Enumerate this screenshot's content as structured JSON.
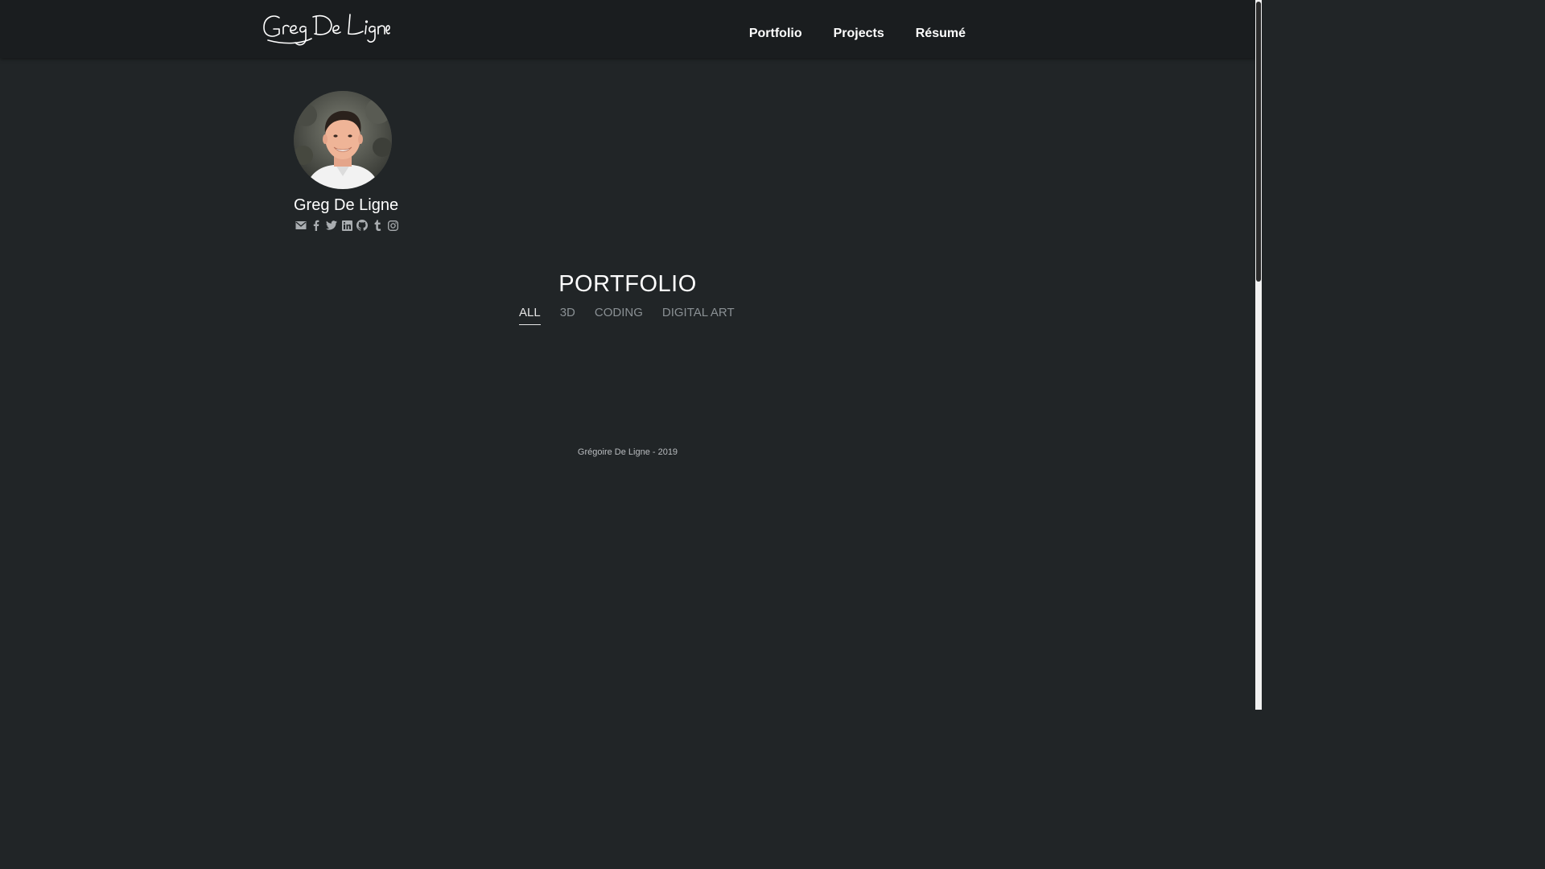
{
  "header": {
    "logo_text": "Greg De Ligne",
    "nav": [
      {
        "label": "Portfolio"
      },
      {
        "label": "Projects"
      },
      {
        "label": "Résumé"
      }
    ]
  },
  "profile": {
    "name": "Greg De Ligne",
    "socials": [
      "mail-icon",
      "facebook-icon",
      "twitter-icon",
      "linkedin-icon",
      "github-icon",
      "tumblr-icon",
      "instagram-icon"
    ]
  },
  "main": {
    "title": "PORTFOLIO",
    "filters": [
      {
        "label": "ALL",
        "active": true
      },
      {
        "label": "3D",
        "active": false
      },
      {
        "label": "CODING",
        "active": false
      },
      {
        "label": "DIGITAL ART",
        "active": false
      }
    ]
  },
  "footer": {
    "text": "Grégoire De Ligne - 2019"
  },
  "colors": {
    "background": "#212527",
    "topbar": "#1a1d1f",
    "inactive_filter": "#8a9094",
    "icon": "#a9adb0"
  }
}
